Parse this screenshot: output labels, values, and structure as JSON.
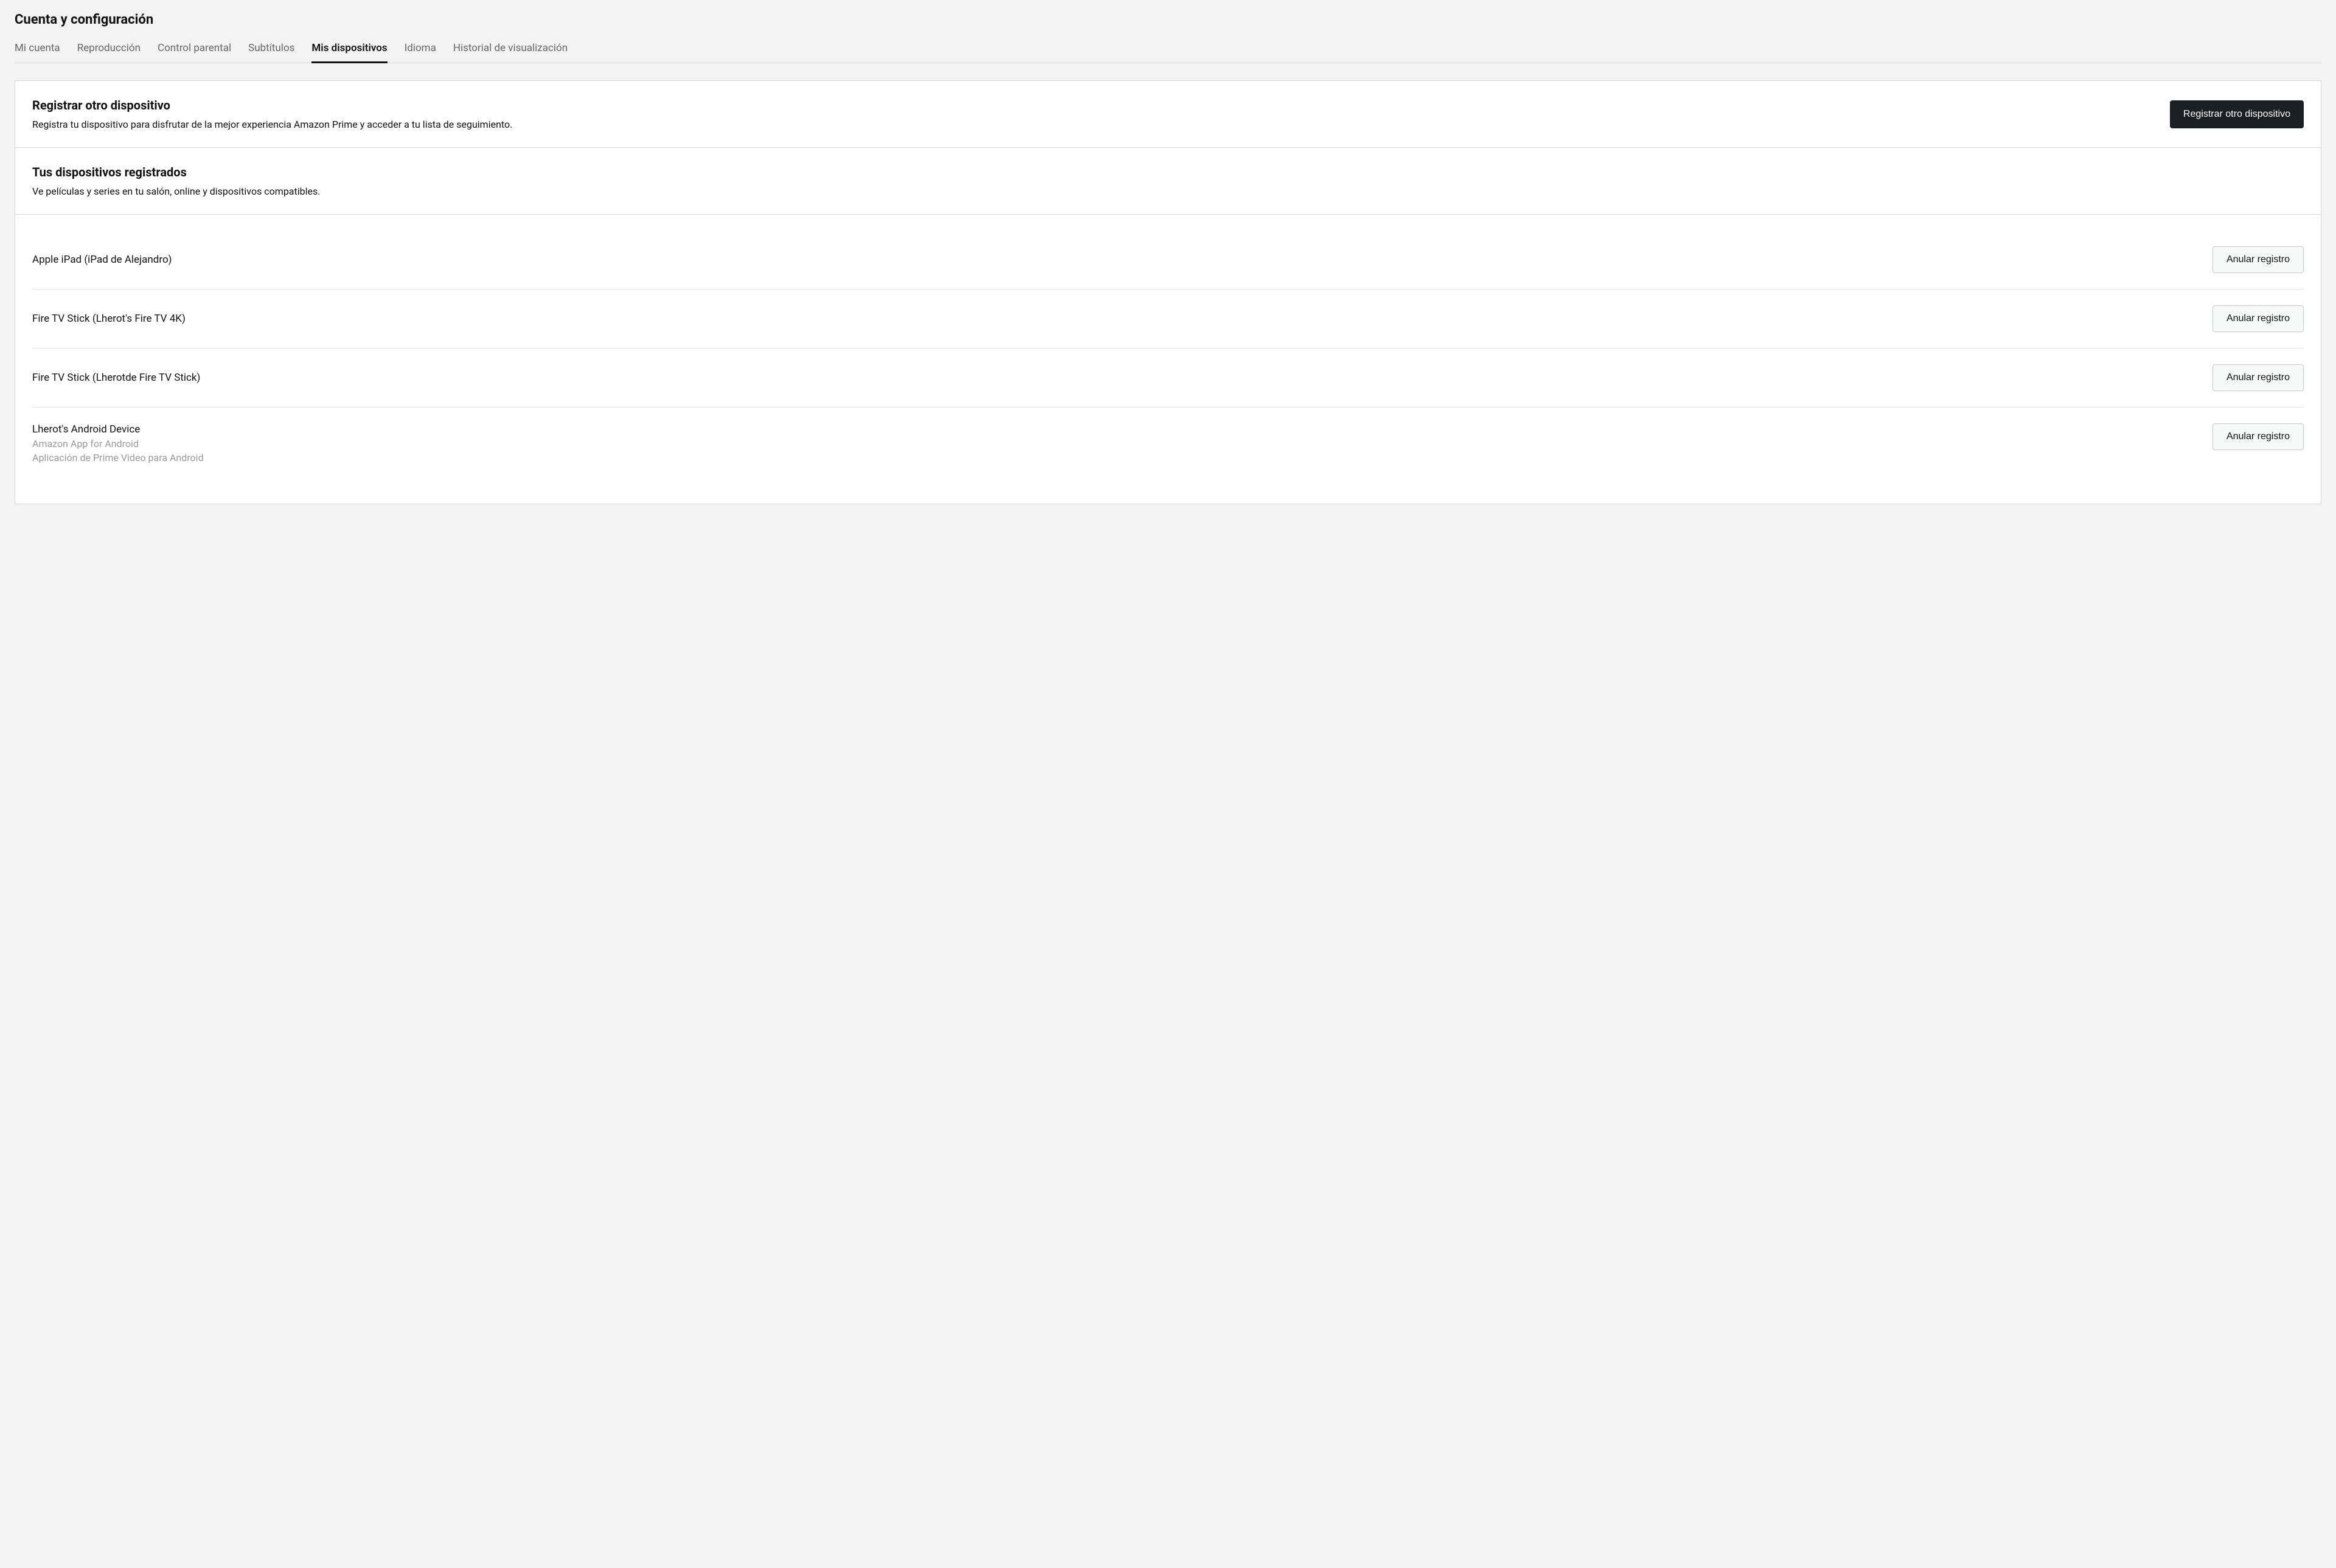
{
  "page": {
    "title": "Cuenta y configuración"
  },
  "tabs": [
    {
      "label": "Mi cuenta",
      "active": false
    },
    {
      "label": "Reproducción",
      "active": false
    },
    {
      "label": "Control parental",
      "active": false
    },
    {
      "label": "Subtítulos",
      "active": false
    },
    {
      "label": "Mis dispositivos",
      "active": true
    },
    {
      "label": "Idioma",
      "active": false
    },
    {
      "label": "Historial de visualización",
      "active": false
    }
  ],
  "register": {
    "heading": "Registrar otro dispositivo",
    "description": "Registra tu dispositivo para disfrutar de la mejor experiencia Amazon Prime y acceder a tu lista de seguimiento.",
    "button_label": "Registrar otro dispositivo"
  },
  "registered": {
    "heading": "Tus dispositivos registrados",
    "subtext": "Ve películas y series en tu salón, online y dispositivos compatibles."
  },
  "deregister_label": "Anular registro",
  "devices": [
    {
      "name": "Apple iPad (iPad de Alejandro)",
      "sublines": []
    },
    {
      "name": "Fire TV Stick (Lherot's Fire TV 4K)",
      "sublines": []
    },
    {
      "name": "Fire TV Stick (Lherotde Fire TV Stick)",
      "sublines": []
    },
    {
      "name": "Lherot's Android Device",
      "sublines": [
        "Amazon App for Android",
        "Aplicación de Prime Video para Android"
      ]
    }
  ]
}
